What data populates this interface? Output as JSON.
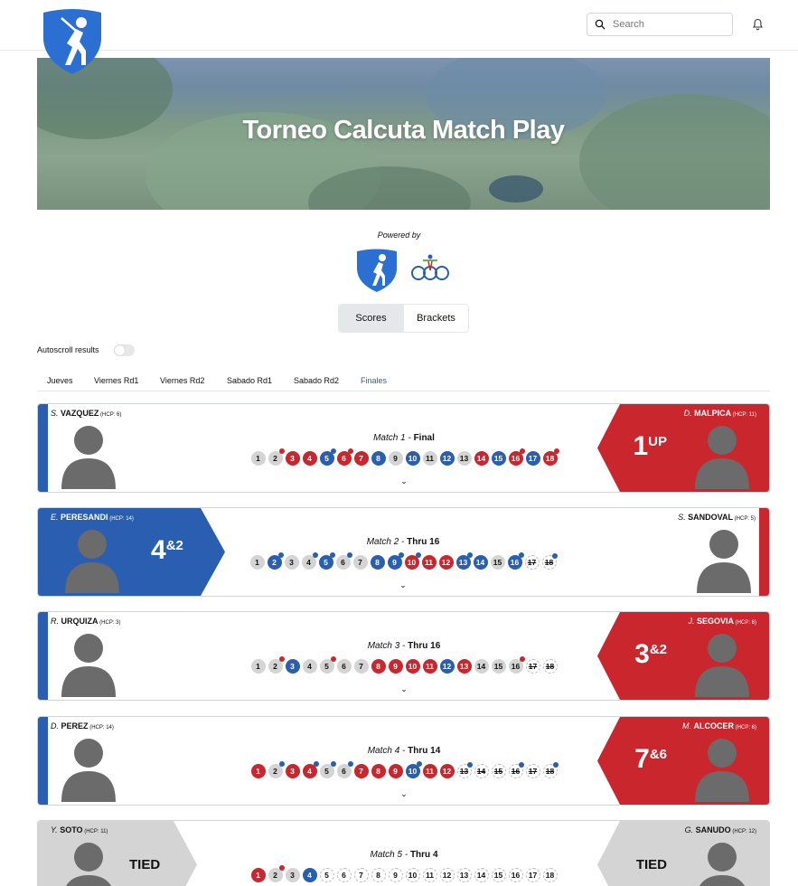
{
  "header": {
    "search_placeholder": "Search"
  },
  "hero": {
    "title": "Torneo Calcuta Match Play"
  },
  "powered_by": "Powered by",
  "segments": [
    {
      "label": "Scores",
      "active": true
    },
    {
      "label": "Brackets",
      "active": false
    }
  ],
  "autoscroll_label": "Autoscroll results",
  "tabs": [
    {
      "label": "Jueves"
    },
    {
      "label": "Viernes Rd1"
    },
    {
      "label": "Viernes Rd2"
    },
    {
      "label": "Sabado Rd1"
    },
    {
      "label": "Sabado Rd2"
    },
    {
      "label": "Finales",
      "active": true
    }
  ],
  "colors": {
    "blue": "#2a5eb0",
    "red": "#c9262e",
    "grey": "#d4d4d4"
  },
  "matches": [
    {
      "title": "Match 1 -",
      "status": "Final",
      "left": {
        "initial": "S.",
        "name": "VAZQUEZ",
        "hcp": "(HCP: 6)"
      },
      "right": {
        "initial": "D.",
        "name": "MALPICA",
        "hcp": "(HCP: 11)"
      },
      "winner": "right",
      "result_big": "1",
      "result_small": "UP",
      "holes": [
        {
          "n": "1",
          "c": "g"
        },
        {
          "n": "2",
          "c": "g",
          "dot": "rd"
        },
        {
          "n": "3",
          "c": "r"
        },
        {
          "n": "4",
          "c": "r"
        },
        {
          "n": "5",
          "c": "b",
          "dot": "bd"
        },
        {
          "n": "6",
          "c": "r",
          "dot": "rd"
        },
        {
          "n": "7",
          "c": "r"
        },
        {
          "n": "8",
          "c": "b"
        },
        {
          "n": "9",
          "c": "g"
        },
        {
          "n": "10",
          "c": "b"
        },
        {
          "n": "11",
          "c": "g"
        },
        {
          "n": "12",
          "c": "b"
        },
        {
          "n": "13",
          "c": "g"
        },
        {
          "n": "14",
          "c": "r"
        },
        {
          "n": "15",
          "c": "b"
        },
        {
          "n": "16",
          "c": "r",
          "dot": "rd"
        },
        {
          "n": "17",
          "c": "b"
        },
        {
          "n": "18",
          "c": "r",
          "dot": "rd"
        }
      ]
    },
    {
      "title": "Match 2 -",
      "status": "Thru 16",
      "left": {
        "initial": "E.",
        "name": "PERESANDI",
        "hcp": "(HCP: 14)"
      },
      "right": {
        "initial": "S.",
        "name": "SANDOVAL",
        "hcp": "(HCP: 5)"
      },
      "winner": "left",
      "result_big": "4",
      "result_small": "&2",
      "holes": [
        {
          "n": "1",
          "c": "g"
        },
        {
          "n": "2",
          "c": "b",
          "dot": "bd"
        },
        {
          "n": "3",
          "c": "g"
        },
        {
          "n": "4",
          "c": "g",
          "dot": "bd"
        },
        {
          "n": "5",
          "c": "b",
          "dot": "bd"
        },
        {
          "n": "6",
          "c": "g",
          "dot": "bd"
        },
        {
          "n": "7",
          "c": "g"
        },
        {
          "n": "8",
          "c": "b"
        },
        {
          "n": "9",
          "c": "b",
          "dot": "bd"
        },
        {
          "n": "10",
          "c": "r",
          "dot": "bd"
        },
        {
          "n": "11",
          "c": "r"
        },
        {
          "n": "12",
          "c": "r"
        },
        {
          "n": "13",
          "c": "b",
          "dot": "bd"
        },
        {
          "n": "14",
          "c": "b"
        },
        {
          "n": "15",
          "c": "g"
        },
        {
          "n": "16",
          "c": "b",
          "dot": "bd"
        },
        {
          "n": "17",
          "c": "w",
          "x": true
        },
        {
          "n": "18",
          "c": "w",
          "x": true,
          "dot": "bd"
        }
      ]
    },
    {
      "title": "Match 3 -",
      "status": "Thru 16",
      "left": {
        "initial": "R.",
        "name": "URQUIZA",
        "hcp": "(HCP: 3)"
      },
      "right": {
        "initial": "J.",
        "name": "SEGOVIA",
        "hcp": "(HCP: 6)"
      },
      "winner": "right",
      "result_big": "3",
      "result_small": "&2",
      "holes": [
        {
          "n": "1",
          "c": "g"
        },
        {
          "n": "2",
          "c": "g",
          "dot": "rd"
        },
        {
          "n": "3",
          "c": "b"
        },
        {
          "n": "4",
          "c": "g"
        },
        {
          "n": "5",
          "c": "g",
          "dot": "rd"
        },
        {
          "n": "6",
          "c": "g"
        },
        {
          "n": "7",
          "c": "g"
        },
        {
          "n": "8",
          "c": "r"
        },
        {
          "n": "9",
          "c": "r"
        },
        {
          "n": "10",
          "c": "r"
        },
        {
          "n": "11",
          "c": "r"
        },
        {
          "n": "12",
          "c": "b"
        },
        {
          "n": "13",
          "c": "r"
        },
        {
          "n": "14",
          "c": "g"
        },
        {
          "n": "15",
          "c": "g"
        },
        {
          "n": "16",
          "c": "g",
          "dot": "rd"
        },
        {
          "n": "17",
          "c": "w",
          "x": true
        },
        {
          "n": "18",
          "c": "w",
          "x": true
        }
      ]
    },
    {
      "title": "Match 4 -",
      "status": "Thru 14",
      "left": {
        "initial": "D.",
        "name": "PEREZ",
        "hcp": "(HCP: 14)"
      },
      "right": {
        "initial": "M.",
        "name": "ALCOCER",
        "hcp": "(HCP: 6)"
      },
      "winner": "right",
      "result_big": "7",
      "result_small": "&6",
      "holes": [
        {
          "n": "1",
          "c": "r"
        },
        {
          "n": "2",
          "c": "g",
          "dot": "bd"
        },
        {
          "n": "3",
          "c": "r"
        },
        {
          "n": "4",
          "c": "r",
          "dot": "bd"
        },
        {
          "n": "5",
          "c": "g",
          "dot": "bd"
        },
        {
          "n": "6",
          "c": "g",
          "dot": "bd"
        },
        {
          "n": "7",
          "c": "r"
        },
        {
          "n": "8",
          "c": "r"
        },
        {
          "n": "9",
          "c": "r"
        },
        {
          "n": "10",
          "c": "b",
          "dot": "bd"
        },
        {
          "n": "11",
          "c": "r"
        },
        {
          "n": "12",
          "c": "r"
        },
        {
          "n": "13",
          "c": "w",
          "x": true,
          "dot": "bd"
        },
        {
          "n": "14",
          "c": "w",
          "x": true
        },
        {
          "n": "15",
          "c": "w",
          "x": true
        },
        {
          "n": "16",
          "c": "w",
          "x": true,
          "dot": "bd"
        },
        {
          "n": "17",
          "c": "w",
          "x": true
        },
        {
          "n": "18",
          "c": "w",
          "x": true,
          "dot": "bd"
        }
      ]
    },
    {
      "title": "Match 5 -",
      "status": "Thru 4",
      "left": {
        "initial": "Y.",
        "name": "SOTO",
        "hcp": "(HCP: 11)"
      },
      "right": {
        "initial": "G.",
        "name": "SANUDO",
        "hcp": "(HCP: 12)"
      },
      "winner": "tied",
      "tied_label": "TIED",
      "holes": [
        {
          "n": "1",
          "c": "r"
        },
        {
          "n": "2",
          "c": "g",
          "dot": "rd"
        },
        {
          "n": "3",
          "c": "g"
        },
        {
          "n": "4",
          "c": "b"
        },
        {
          "n": "5",
          "c": "w"
        },
        {
          "n": "6",
          "c": "w"
        },
        {
          "n": "7",
          "c": "w"
        },
        {
          "n": "8",
          "c": "w"
        },
        {
          "n": "9",
          "c": "w"
        },
        {
          "n": "10",
          "c": "w"
        },
        {
          "n": "11",
          "c": "w"
        },
        {
          "n": "12",
          "c": "w"
        },
        {
          "n": "13",
          "c": "w"
        },
        {
          "n": "14",
          "c": "w"
        },
        {
          "n": "15",
          "c": "w"
        },
        {
          "n": "16",
          "c": "w"
        },
        {
          "n": "17",
          "c": "w"
        },
        {
          "n": "18",
          "c": "w"
        }
      ]
    }
  ]
}
